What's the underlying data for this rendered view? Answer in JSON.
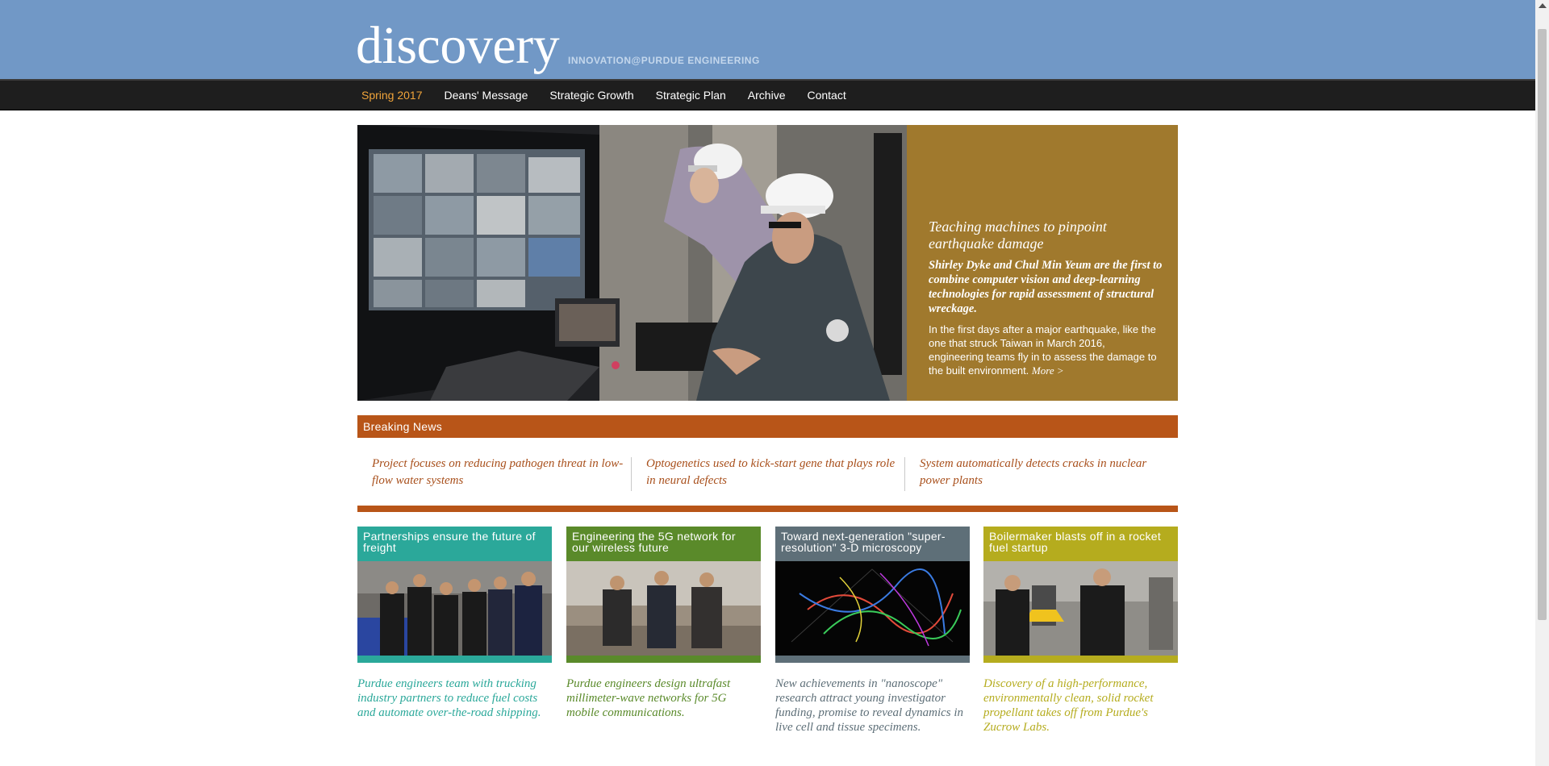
{
  "header": {
    "logo": "discovery",
    "tagline": "INNOVATION@PURDUE ENGINEERING"
  },
  "nav": {
    "items": [
      {
        "label": "Spring 2017",
        "active": true
      },
      {
        "label": "Deans' Message"
      },
      {
        "label": "Strategic Growth"
      },
      {
        "label": "Strategic Plan"
      },
      {
        "label": "Archive"
      },
      {
        "label": "Contact"
      }
    ]
  },
  "hero": {
    "title": "Teaching machines to pinpoint earthquake damage",
    "subtitle": "Shirley Dyke and Chul Min Yeum are the first to combine computer vision and deep-learning technologies for rapid assessment of structural wreckage.",
    "body": "In the first days after a major earthquake, like the one that struck Taiwan in March 2016, engineering teams fly in to assess the damage to the built environment.",
    "more": "More >"
  },
  "breaking_news": {
    "label": "Breaking News",
    "items": [
      "Project focuses on reducing pathogen threat in low-flow water systems",
      "Optogenetics used to kick-start gene that plays role in neural defects",
      "System automatically detects cracks in nuclear power plants"
    ]
  },
  "cards": [
    {
      "title": "Partnerships ensure the future of freight",
      "desc": "Purdue engineers team with trucking industry partners to reduce fuel costs and automate over-the-road shipping.",
      "color": "#2ba89a"
    },
    {
      "title": "Engineering the 5G network for our wireless future",
      "desc": "Purdue engineers design ultrafast millimeter-wave networks for 5G mobile communications.",
      "color": "#5a8a2a"
    },
    {
      "title": "Toward next-generation \"super-resolution\" 3-D microscopy",
      "desc": "New achievements in \"nanoscope\" research attract young investigator funding, promise to reveal dynamics in live cell and tissue specimens.",
      "color": "#5e6f78"
    },
    {
      "title": "Boilermaker blasts off in a rocket fuel startup",
      "desc": "Discovery of a high-performance, environmentally clean, solid rocket propellant takes off from Purdue's Zucrow Labs.",
      "color": "#b5ac1e"
    }
  ],
  "colors": {
    "header_bg": "#7198c6",
    "nav_bg": "#1e1e1e",
    "nav_active": "#f0a43a",
    "hero_panel": "#a0792d",
    "breaking": "#b85518"
  }
}
